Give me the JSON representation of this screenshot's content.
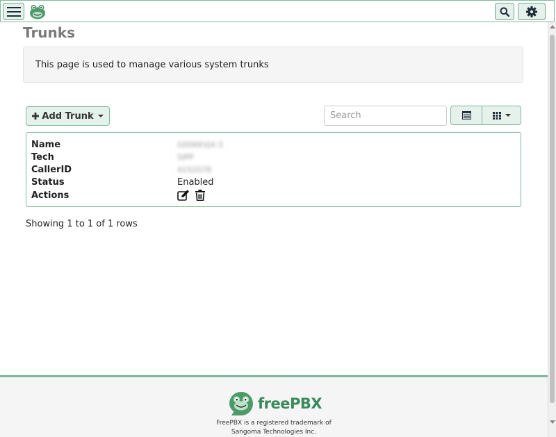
{
  "page": {
    "title": "Trunks",
    "description": "This page is used to manage various system trunks"
  },
  "toolbar": {
    "add_trunk_label": "Add Trunk",
    "search_placeholder": "Search"
  },
  "trunk": {
    "fields": [
      {
        "label": "Name",
        "value": "G00KKVJ4-3",
        "redacted": true
      },
      {
        "label": "Tech",
        "value": "SIPP",
        "redacted": true
      },
      {
        "label": "CallerID",
        "value": "4152078",
        "redacted": true
      },
      {
        "label": "Status",
        "value": "Enabled",
        "redacted": false
      },
      {
        "label": "Actions",
        "value": "",
        "redacted": false
      }
    ]
  },
  "pagination": {
    "summary": "Showing 1 to 1 of 1 rows"
  },
  "footer": {
    "brand": "freePBX",
    "trademark_line1": "FreePBX is a registered trademark of",
    "trademark_line2": "Sangoma Technologies Inc."
  },
  "icons": {
    "menu": "hamburger-icon",
    "logo": "frog-logo-icon",
    "search": "search-icon",
    "settings": "gear-icon",
    "add": "plus-icon",
    "table_view": "list-view-icon",
    "columns": "grid-icon",
    "edit": "edit-icon",
    "delete": "trash-icon"
  },
  "colors": {
    "accent": "#7fb79a",
    "accent_bg": "#e5f1eb",
    "brand_green": "#3a8a5d",
    "title_gray": "#7a7a7a"
  }
}
